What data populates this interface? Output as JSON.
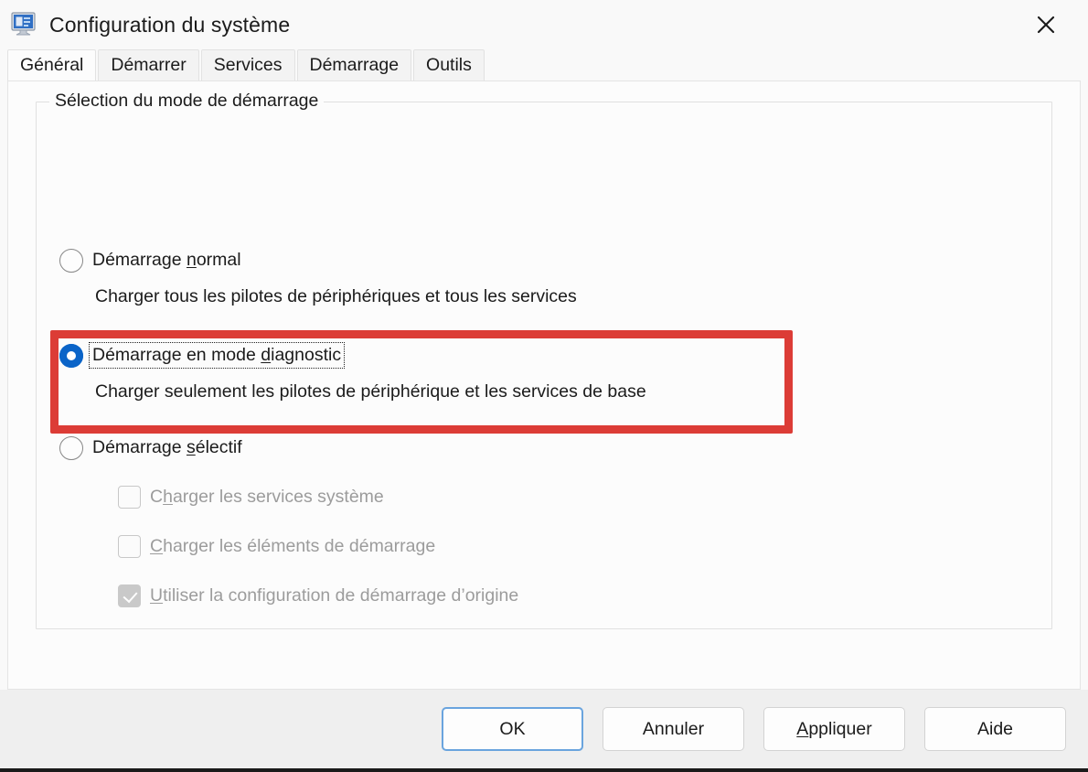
{
  "window": {
    "title": "Configuration du système",
    "icon": "system-configuration-icon",
    "close_label": "×"
  },
  "tabs": [
    {
      "label": "Général",
      "active": true
    },
    {
      "label": "Démarrer",
      "active": false
    },
    {
      "label": "Services",
      "active": false
    },
    {
      "label": "Démarrage",
      "active": false
    },
    {
      "label": "Outils",
      "active": false
    }
  ],
  "groupbox": {
    "label": "Sélection du mode de démarrage"
  },
  "startup_modes": [
    {
      "label_pre": "Démarrage ",
      "accel": "n",
      "label_post": "ormal",
      "description": "Charger tous les pilotes de périphériques et tous les services",
      "selected": false,
      "focused": false
    },
    {
      "label_pre": "Démarrage en mode ",
      "accel": "d",
      "label_post": "iagnostic",
      "description": "Charger seulement les pilotes de périphérique et les services de base",
      "selected": true,
      "focused": true
    },
    {
      "label_pre": "Démarrage ",
      "accel": "s",
      "label_post": "électif",
      "description": "",
      "selected": false,
      "focused": false
    }
  ],
  "selective_options": [
    {
      "label_pre": "C",
      "accel": "h",
      "label_post": "arger les services système",
      "checked": false,
      "disabled": true
    },
    {
      "label_pre": "",
      "accel": "C",
      "label_post": "harger les éléments de démarrage",
      "checked": false,
      "disabled": true
    },
    {
      "label_pre": "",
      "accel": "U",
      "label_post": "tiliser la configuration de démarrage d’origine",
      "checked": true,
      "disabled": true
    }
  ],
  "buttons": [
    {
      "label_pre": "OK",
      "accel": "",
      "label_post": "",
      "default": true
    },
    {
      "label_pre": "Annuler",
      "accel": "",
      "label_post": "",
      "default": false
    },
    {
      "label_pre": "",
      "accel": "A",
      "label_post": "ppliquer",
      "default": false
    },
    {
      "label_pre": "Aide",
      "accel": "",
      "label_post": "",
      "default": false
    }
  ],
  "colors": {
    "highlight_red": "#dc3c36",
    "accent_blue": "#0b64c8",
    "default_button_border": "#6aa4de"
  }
}
